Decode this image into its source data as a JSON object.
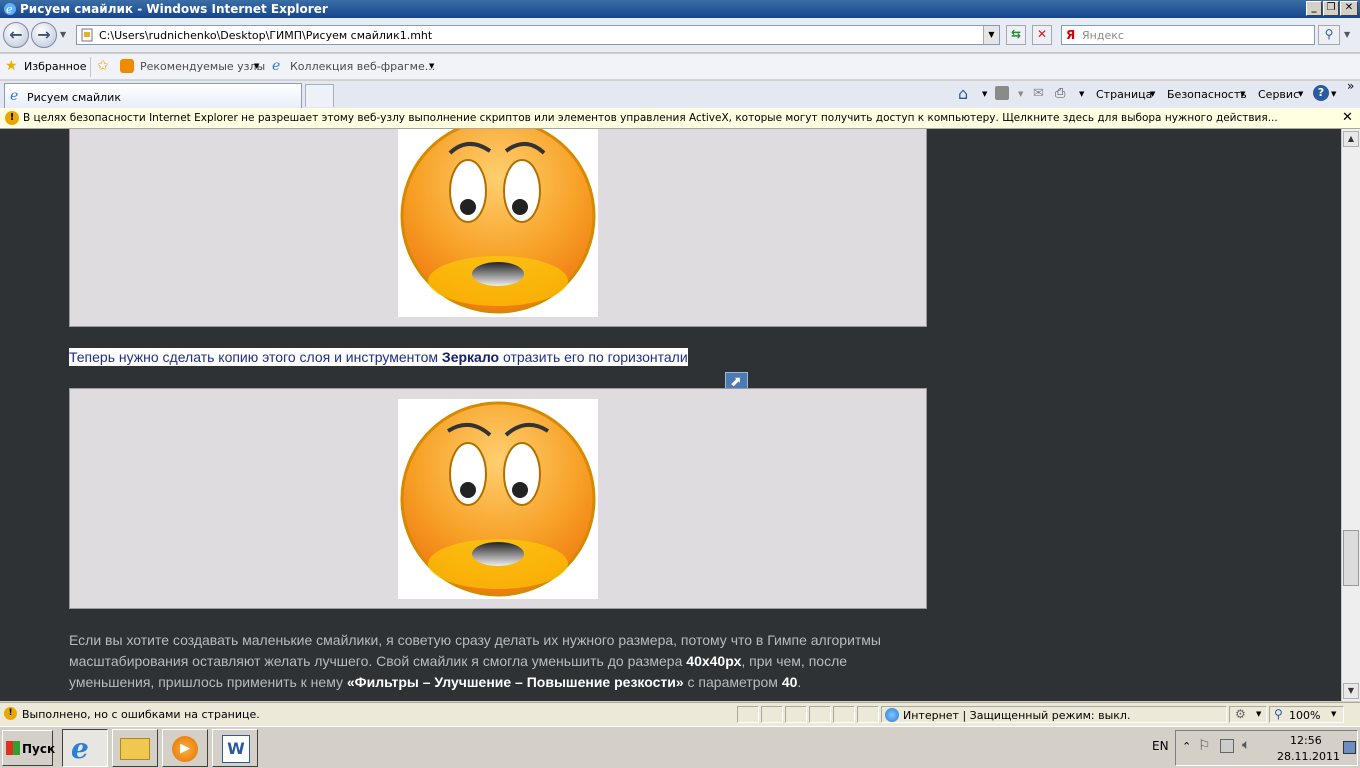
{
  "window": {
    "title": "Рисуем смайлик - Windows Internet Explorer"
  },
  "address_bar": {
    "url": "C:\\Users\\rudnichenko\\Desktop\\ГИМП\\Рисуем смайлик1.mht"
  },
  "search": {
    "placeholder": "Яндекс",
    "logo": "Я"
  },
  "favorites_bar": {
    "favorites_label": "Избранное",
    "items": [
      "Рекомендуемые узлы",
      "Коллекция веб-фрагме..."
    ]
  },
  "tab": {
    "title": "Рисуем смайлик"
  },
  "command_bar": {
    "page": "Страница",
    "security": "Безопасность",
    "service": "Сервис"
  },
  "info_bar": {
    "message": "В целях безопасности Internet Explorer не разрешает этому веб-узлу выполнение скриптов или элементов управления ActiveX, которые могут получить доступ к компьютеру. Щелкните здесь для выбора нужного действия..."
  },
  "content": {
    "highlight_text_1": "Теперь нужно сделать копию этого слоя и инструментом ",
    "highlight_bold": "Зеркало",
    "highlight_text_2": " отразить его по горизонтали",
    "para_1": "Если вы хотите создавать маленькие смайлики, я советую сразу делать их нужного размера, потому что в Гимпе алгоритмы масштабирования оставляют желать лучшего. Свой смайлик я смогла уменьшить до размера ",
    "para_bold_1": "40х40рх",
    "para_2": ", при чем, после уменьшения, пришлось применить к нему ",
    "para_bold_2": "«Фильтры – Улучшение – Повышение резкости»",
    "para_3": " с параметром ",
    "para_bold_3": "40",
    "para_4": "."
  },
  "status_bar": {
    "status": "Выполнено, но с ошибками на странице.",
    "zone": "Интернет | Защищенный режим: выкл.",
    "zoom": "100%"
  },
  "taskbar": {
    "start": "Пуск",
    "lang": "EN",
    "time": "12:56",
    "date": "28.11.2011"
  },
  "colors": {
    "content_bg": "#2e3234",
    "highlight_text": "#1f2f86",
    "smiley_orange": "#f39c12"
  }
}
